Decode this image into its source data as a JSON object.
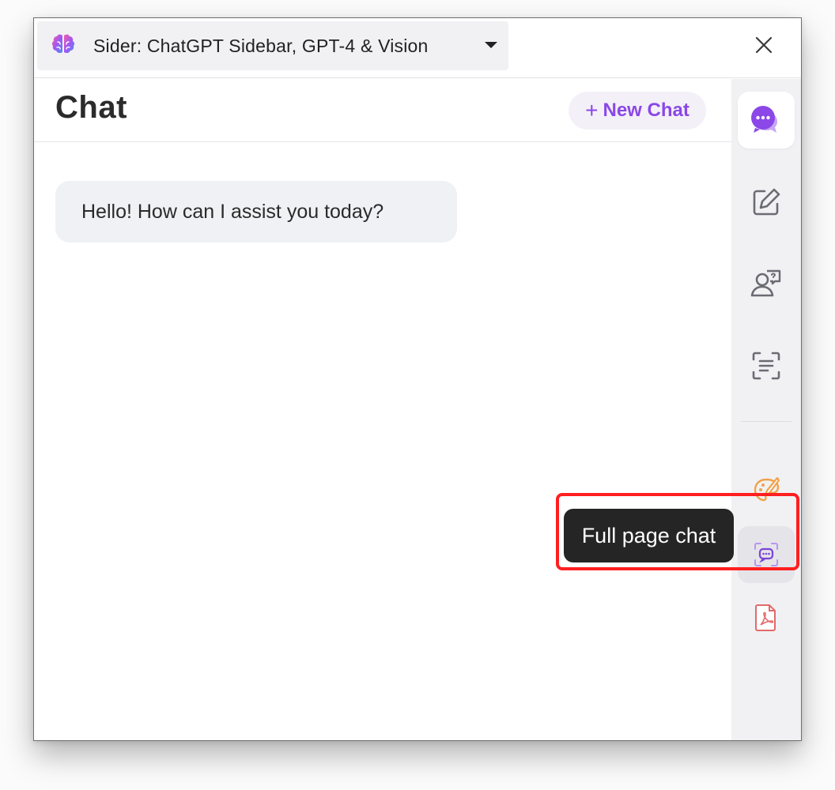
{
  "titlebar": {
    "extension_name": "Sider: ChatGPT Sidebar, GPT-4 & Vision",
    "logo_icon": "brain-icon",
    "close_icon": "close-icon"
  },
  "chat": {
    "title": "Chat",
    "new_chat_label": "New Chat",
    "new_chat_plus": "+",
    "messages": [
      {
        "role": "assistant",
        "text": "Hello! How can I assist you today?"
      }
    ]
  },
  "sidebar": {
    "items": [
      {
        "id": "chat",
        "icon": "chat-bubbles-icon",
        "active": true
      },
      {
        "id": "write",
        "icon": "edit-icon",
        "active": false
      },
      {
        "id": "ask",
        "icon": "user-question-icon",
        "active": false
      },
      {
        "id": "ocr",
        "icon": "scan-text-icon",
        "active": false
      },
      {
        "id": "art",
        "icon": "paint-brush-icon",
        "active": false
      },
      {
        "id": "full-page-chat",
        "icon": "full-page-chat-icon",
        "active": false,
        "hover": true
      },
      {
        "id": "pdf",
        "icon": "pdf-icon",
        "active": false
      }
    ]
  },
  "tooltip": {
    "text": "Full page chat"
  },
  "colors": {
    "accent": "#8b47e8",
    "highlight": "#ff1f1f",
    "tooltip_bg": "#252525",
    "sidebar_bg": "#f1f1f4",
    "bubble_bg": "#f0f1f5"
  }
}
